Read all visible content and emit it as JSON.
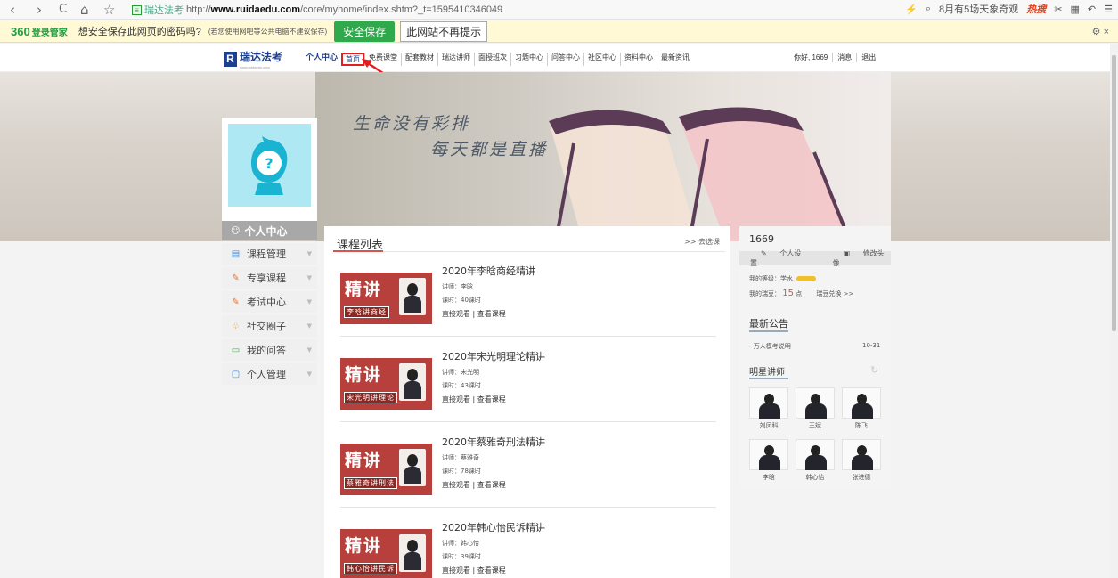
{
  "browser": {
    "back": "‹",
    "forward": "›",
    "refresh": "C",
    "home": "⌂",
    "star": "☆",
    "site_name": "瑞达法考",
    "url_prefix": "http://",
    "url_host": "www.ruidaedu.com",
    "url_path": "/core/myhome/index.shtm?_t=1595410346049",
    "search_text": "8月有5场天象奇观",
    "hot_label": "热搜",
    "menu_icon": "☰"
  },
  "password_bar": {
    "logo": "360",
    "logo_sub": "登录管家",
    "question": "想安全保存此网页的密码吗?",
    "note": "(若您使用网吧等公共电脑不建议保存)",
    "save": "安全保存",
    "never": "此网站不再提示",
    "tail": "⚙ ×"
  },
  "site_nav": {
    "brand": "瑞达法考",
    "brand_url": "www.ruidaedu.com",
    "links": [
      "个人中心",
      "首页",
      "免费课堂",
      "配套教材",
      "瑞达讲师",
      "面授班次",
      "习题中心",
      "问答中心",
      "社区中心",
      "资料中心",
      "最新资讯"
    ],
    "user_links": [
      "你好, 1669",
      "消息",
      "退出"
    ]
  },
  "banner": {
    "line1": "生命没有彩排",
    "line2": "每天都是直播"
  },
  "left_menu": {
    "title": "个人中心",
    "items": [
      {
        "label": "课程管理",
        "icon": "▤"
      },
      {
        "label": "专享课程",
        "icon": "✎"
      },
      {
        "label": "考试中心",
        "icon": "✎"
      },
      {
        "label": "社交圈子",
        "icon": "♧"
      },
      {
        "label": "我的问答",
        "icon": "▭"
      },
      {
        "label": "个人管理",
        "icon": "▢"
      }
    ]
  },
  "courses": {
    "title": "课程列表",
    "more": ">> 去选课",
    "big_char": "精讲",
    "items": [
      {
        "name": "2020年李晗商经精讲",
        "teacher": "讲师：李晗",
        "hours": "课时：40课时",
        "badge": "李晗讲商经",
        "watch": "直接观看",
        "view": "查看课程"
      },
      {
        "name": "2020年宋光明理论精讲",
        "teacher": "讲师：宋光明",
        "hours": "课时：43课时",
        "badge": "宋光明讲理论",
        "watch": "直接观看",
        "view": "查看课程"
      },
      {
        "name": "2020年蔡雅奇刑法精讲",
        "teacher": "讲师：蔡雅奇",
        "hours": "课时：78课时",
        "badge": "蔡雅奇讲刑法",
        "watch": "直接观看",
        "view": "查看课程"
      },
      {
        "name": "2020年韩心怡民诉精讲",
        "teacher": "讲师：韩心怡",
        "hours": "课时：39课时",
        "badge": "韩心怡讲民诉",
        "watch": "直接观看",
        "view": "查看课程"
      }
    ]
  },
  "profile": {
    "name": "1669",
    "settings": "个人设置",
    "avatar_edit": "修改头像",
    "level_label": "我的等级：学水",
    "points_label": "我的瑞豆：",
    "points": "15",
    "points_unit": "点",
    "exchange": "瑞豆兑换 >>"
  },
  "notice": {
    "title": "最新公告",
    "item": "- 万人模考说明",
    "date": "10-31"
  },
  "teachers": {
    "title": "明星讲师",
    "refresh_icon": "↻",
    "names": [
      "刘凤科",
      "王斌",
      "陈飞",
      "李晗",
      "韩心怡",
      "张进德"
    ]
  },
  "colors": {
    "accent": "#d9534f",
    "brand": "#1d3f8f",
    "save_green": "#2fa94b",
    "thumb_red": "#b8403c"
  }
}
